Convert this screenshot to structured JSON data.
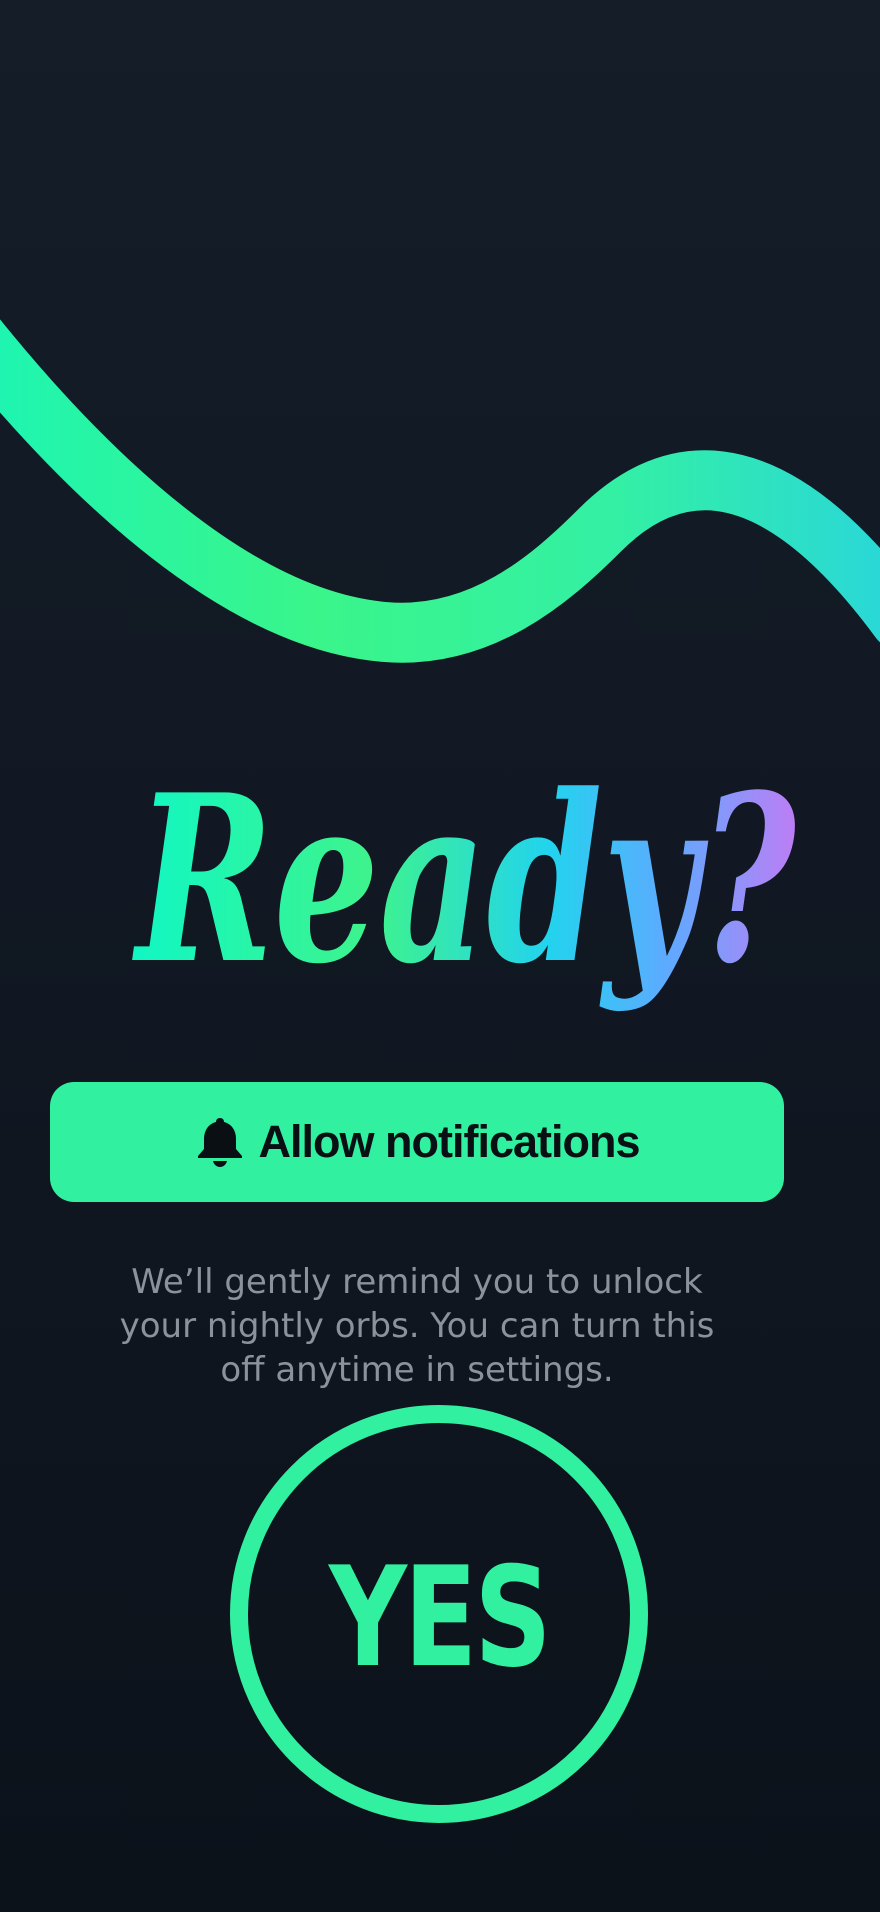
{
  "headline": "Ready?",
  "allow_button": {
    "label": "Allow notifications",
    "icon": "bell-icon"
  },
  "helper_text": "We’ll gently remind you to unlock your nightly orbs. You can turn this off anytime in settings.",
  "yes_button": {
    "label": "YES"
  },
  "colors": {
    "background": "#121a24",
    "accent_green": "#31f0a0",
    "gradient_start": "#1de9b6",
    "gradient_mid": "#2fe88a",
    "gradient_cyan": "#22d3ee",
    "gradient_blue": "#60a5fa",
    "gradient_purple": "#c084fc",
    "helper_text": "#8a929c",
    "button_text": "#0a0f14"
  }
}
